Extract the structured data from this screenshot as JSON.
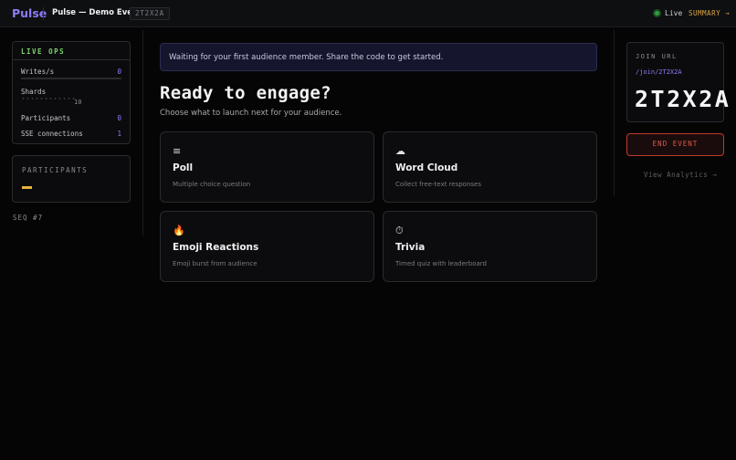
{
  "app": {
    "logo": "Pulse",
    "event_title": "Pulse — Demo Event",
    "event_code": "2T2X2A"
  },
  "header": {
    "live_label": "Live",
    "summary_label": "SUMMARY →"
  },
  "live_ops": {
    "title": "LIVE OPS",
    "writes_label": "Writes/s",
    "writes_value": "0",
    "shards_label": "Shards",
    "shards_value": "10",
    "participants_label": "Participants",
    "participants_value": "0",
    "sse_label": "SSE connections",
    "sse_value": "1"
  },
  "participants_panel": {
    "title": "PARTICIPANTS"
  },
  "seq": "SEQ #7",
  "main": {
    "banner": "Waiting for your first audience member. Share the code to get started.",
    "headline": "Ready to engage?",
    "subhead": "Choose what to launch next for your audience.",
    "options": [
      {
        "icon": "≡",
        "icon_name": "list-icon",
        "title": "Poll",
        "desc": "Multiple choice question"
      },
      {
        "icon": "☁",
        "icon_name": "cloud-icon",
        "title": "Word Cloud",
        "desc": "Collect free-text responses"
      },
      {
        "icon": "🔥",
        "icon_name": "fire-icon",
        "title": "Emoji Reactions",
        "desc": "Emoji burst from audience"
      },
      {
        "icon": "⏱",
        "icon_name": "stopwatch-icon",
        "title": "Trivia",
        "desc": "Timed quiz with leaderboard"
      }
    ]
  },
  "join": {
    "title": "JOIN URL",
    "url": "/join/2T2X2A",
    "code": "2T2X2A"
  },
  "actions": {
    "end_event": "END EVENT",
    "view_analytics": "View Analytics →"
  },
  "colors": {
    "accent": "#8b7cf6",
    "live": "#2f9e44",
    "summary": "#d9a441",
    "danger": "#c0392b",
    "ops": "#7ed56f"
  }
}
